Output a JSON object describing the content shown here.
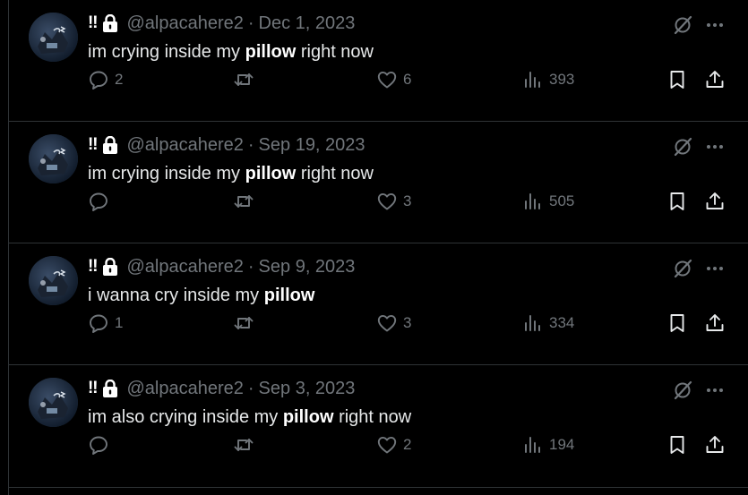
{
  "colors": {
    "background": "#000000",
    "text": "#e7e9ea",
    "muted": "#71767b",
    "divider": "#2f3336"
  },
  "tweets": [
    {
      "badge": "‼",
      "handle": "@alpacahere2",
      "separator": "·",
      "date": "Dec 1, 2023",
      "text_before": "im crying inside my ",
      "text_bold": "pillow",
      "text_after": " right now",
      "replies": "2",
      "retweets": "",
      "likes": "6",
      "views": "393"
    },
    {
      "badge": "‼",
      "handle": "@alpacahere2",
      "separator": "·",
      "date": "Sep 19, 2023",
      "text_before": "im crying inside my ",
      "text_bold": "pillow",
      "text_after": " right now",
      "replies": "",
      "retweets": "",
      "likes": "3",
      "views": "505"
    },
    {
      "badge": "‼",
      "handle": "@alpacahere2",
      "separator": "·",
      "date": "Sep 9, 2023",
      "text_before": "i wanna cry inside my ",
      "text_bold": "pillow",
      "text_after": "",
      "replies": "1",
      "retweets": "",
      "likes": "3",
      "views": "334"
    },
    {
      "badge": "‼",
      "handle": "@alpacahere2",
      "separator": "·",
      "date": "Sep 3, 2023",
      "text_before": "im also crying inside my ",
      "text_bold": "pillow",
      "text_after": " right now",
      "replies": "",
      "retweets": "",
      "likes": "2",
      "views": "194"
    }
  ],
  "icons": {
    "lock": "lock-icon",
    "grok": "grok-icon",
    "more": "more-icon",
    "reply": "reply-icon",
    "retweet": "retweet-icon",
    "like": "heart-icon",
    "views": "views-icon",
    "bookmark": "bookmark-icon",
    "share": "share-icon"
  }
}
